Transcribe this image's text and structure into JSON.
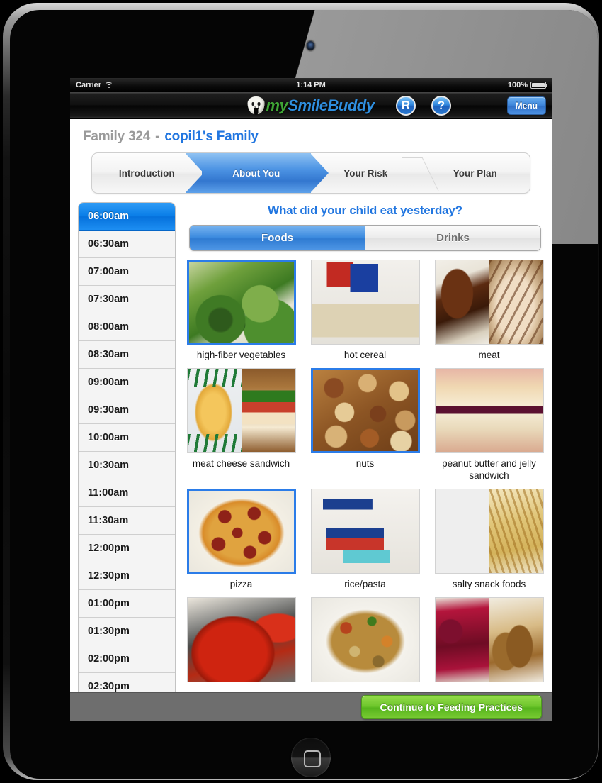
{
  "device": {
    "camera_icon": "camera-icon",
    "home_button_icon": "home-button-icon"
  },
  "statusbar": {
    "carrier": "Carrier",
    "wifi_icon": "wifi-icon",
    "time": "1:14 PM",
    "battery_percent": "100%",
    "battery_icon": "battery-icon"
  },
  "navbar": {
    "logo_tooth_icon": "tooth-logo-icon",
    "logo_my": "my",
    "logo_smilebuddy": "SmileBuddy",
    "resources_button": "R",
    "help_button": "?",
    "menu_button": "Menu"
  },
  "header": {
    "family_id": "Family 324",
    "dash": "-",
    "family_name": "copil1's Family"
  },
  "breadcrumb": {
    "steps": [
      {
        "label": "Introduction",
        "active": false
      },
      {
        "label": "About You",
        "active": true
      },
      {
        "label": "Your Risk",
        "active": false
      },
      {
        "label": "Your Plan",
        "active": false
      }
    ]
  },
  "timeslots": {
    "items": [
      {
        "label": "06:00am",
        "selected": true
      },
      {
        "label": "06:30am",
        "selected": false
      },
      {
        "label": "07:00am",
        "selected": false
      },
      {
        "label": "07:30am",
        "selected": false
      },
      {
        "label": "08:00am",
        "selected": false
      },
      {
        "label": "08:30am",
        "selected": false
      },
      {
        "label": "09:00am",
        "selected": false
      },
      {
        "label": "09:30am",
        "selected": false
      },
      {
        "label": "10:00am",
        "selected": false
      },
      {
        "label": "10:30am",
        "selected": false
      },
      {
        "label": "11:00am",
        "selected": false
      },
      {
        "label": "11:30am",
        "selected": false
      },
      {
        "label": "12:00pm",
        "selected": false
      },
      {
        "label": "12:30pm",
        "selected": false
      },
      {
        "label": "01:00pm",
        "selected": false
      },
      {
        "label": "01:30pm",
        "selected": false
      },
      {
        "label": "02:00pm",
        "selected": false
      },
      {
        "label": "02:30pm",
        "selected": false
      }
    ]
  },
  "main": {
    "question": "What did your child eat yesterday?",
    "tabs": [
      {
        "label": "Foods",
        "active": true
      },
      {
        "label": "Drinks",
        "active": false
      }
    ],
    "foods": [
      {
        "label": "high-fiber vegetables",
        "selected": true,
        "art": "veg"
      },
      {
        "label": "hot cereal",
        "selected": false,
        "art": "cereal"
      },
      {
        "label": "meat",
        "selected": false,
        "art": "meat"
      },
      {
        "label": "meat cheese sandwich",
        "selected": false,
        "art": "empsand"
      },
      {
        "label": "nuts",
        "selected": true,
        "art": "nuts"
      },
      {
        "label": "peanut butter and jelly sandwich",
        "selected": false,
        "art": "pbj"
      },
      {
        "label": "pizza",
        "selected": true,
        "art": "pizza"
      },
      {
        "label": "rice/pasta",
        "selected": false,
        "art": "rice"
      },
      {
        "label": "salty snack foods",
        "selected": false,
        "art": "snack"
      },
      {
        "label": "",
        "selected": false,
        "art": "sauce"
      },
      {
        "label": "",
        "selected": false,
        "art": "soup"
      },
      {
        "label": "",
        "selected": false,
        "art": "jampb"
      }
    ]
  },
  "toolbar": {
    "continue_label": "Continue to Feeding Practices"
  },
  "colors": {
    "accent_blue": "#2176e0",
    "selected_blue": "#0a7ee8",
    "continue_green": "#6ec62c",
    "toolbar_gray": "#6e6e6e",
    "logo_green": "#3fa535"
  }
}
